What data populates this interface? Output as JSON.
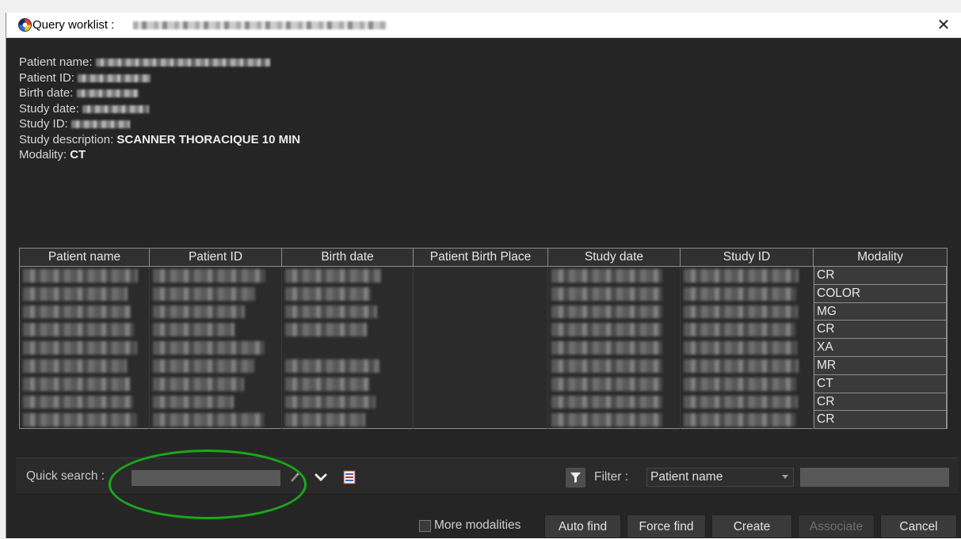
{
  "window": {
    "title": "Query worklist :",
    "close_glyph": "✕"
  },
  "patient_info": {
    "patient_name_label": "Patient name:",
    "patient_id_label": "Patient ID:",
    "birth_date_label": "Birth date:",
    "study_date_label": "Study date:",
    "study_id_label": "Study ID:",
    "study_description_label": "Study description:",
    "study_description_value": "SCANNER THORACIQUE 10 MIN",
    "modality_label": "Modality:",
    "modality_value": "CT"
  },
  "table": {
    "columns": [
      "Patient name",
      "Patient ID",
      "Birth date",
      "Patient Birth Place",
      "Study date",
      "Study ID",
      "Modality"
    ],
    "modalities": [
      "CR",
      "COLOR",
      "MG",
      "CR",
      "XA",
      "MR",
      "CT",
      "CR",
      "CR"
    ]
  },
  "search": {
    "quick_search_label": "Quick search :",
    "quick_search_value": "",
    "filter_label": "Filter :",
    "filter_selected": "Patient name",
    "filter_value": ""
  },
  "actions": {
    "more_modalities_label": "More modalities",
    "auto_find_label": "Auto find",
    "force_find_label": "Force find",
    "create_label": "Create",
    "associate_label": "Associate",
    "cancel_label": "Cancel"
  },
  "colors": {
    "background": "#252525",
    "highlight_ellipse": "#1ea51e"
  }
}
